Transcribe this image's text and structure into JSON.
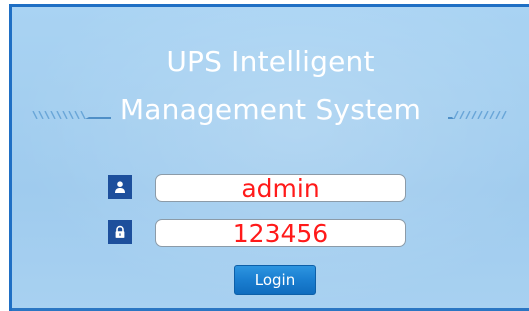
{
  "login": {
    "title_line1": "UPS Intelligent",
    "title_line2": "Management System",
    "username_value": "admin",
    "password_value": "123456",
    "login_label": "Login",
    "icons": {
      "username": "user-icon",
      "password": "lock-icon"
    }
  },
  "colors": {
    "background": "#a6d0f1",
    "border": "#1f6fc4",
    "field_text": "#ff1a1a",
    "icon_box": "#1d4f9c",
    "button": "#1a7ed0"
  }
}
